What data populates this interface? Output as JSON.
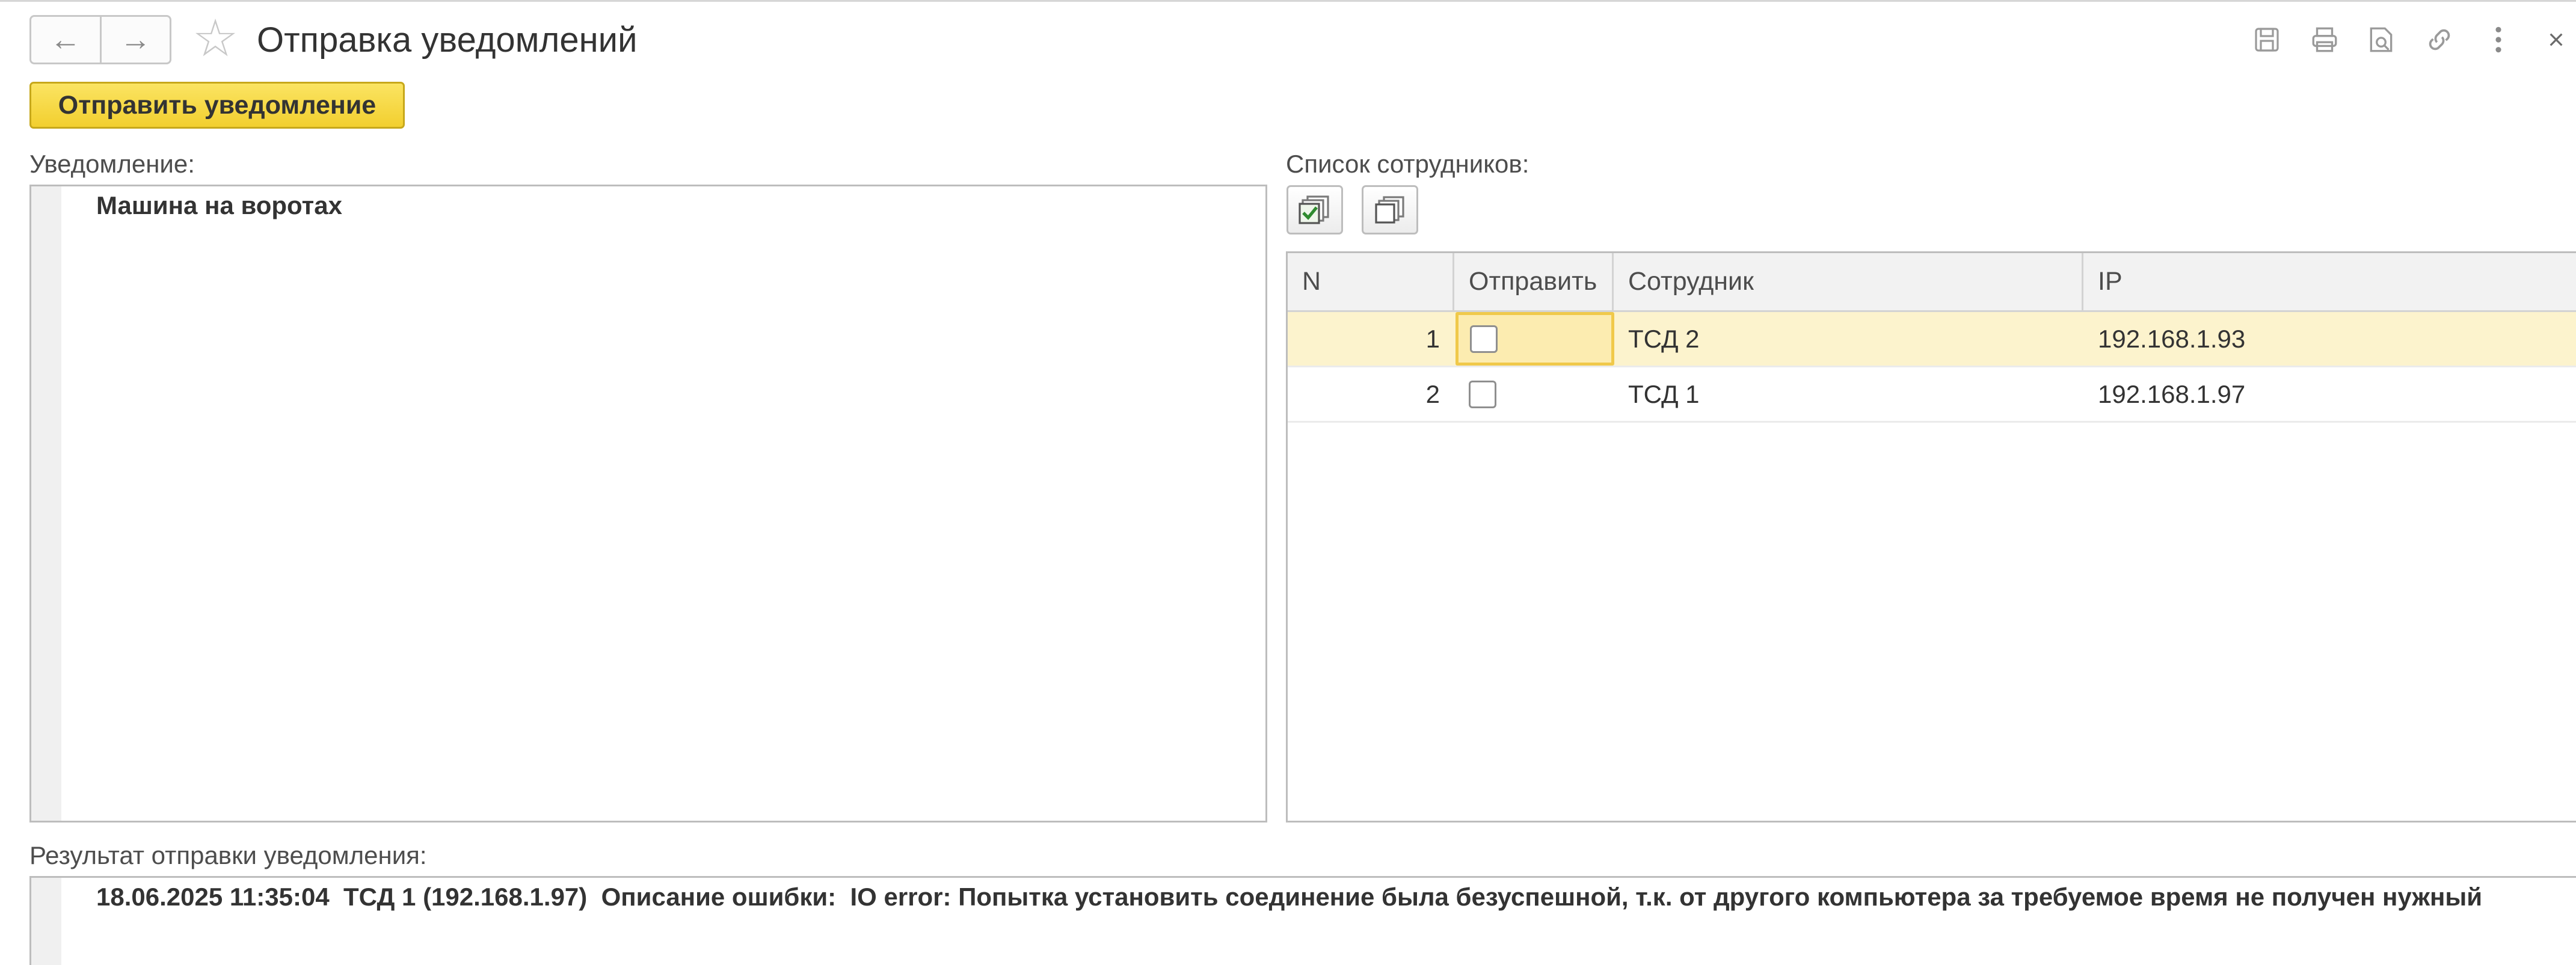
{
  "window": {
    "title": "Отправка уведомлений",
    "favorite_icon": "star-icon",
    "nav": {
      "back_icon": "arrow-left-icon",
      "forward_icon": "arrow-right-icon"
    },
    "toolbar_icons": [
      "save-icon",
      "print-icon",
      "preview-icon",
      "link-icon",
      "more-icon",
      "close-icon"
    ]
  },
  "actions": {
    "send_label": "Отправить уведомление"
  },
  "notification": {
    "label": "Уведомление:",
    "text": "Машина на воротах"
  },
  "employees": {
    "label": "Список сотрудников:",
    "columns": {
      "n": "N",
      "send": "Отправить",
      "employee": "Сотрудник",
      "ip": "IP"
    },
    "rows": [
      {
        "n": "1",
        "send": false,
        "employee": "ТСД 2",
        "ip": "192.168.1.93"
      },
      {
        "n": "2",
        "send": false,
        "employee": "ТСД 1",
        "ip": "192.168.1.97"
      }
    ]
  },
  "result": {
    "label": "Результат отправки уведомления:",
    "text": "18.06.2025 11:35:04  ТСД 1 (192.168.1.97)  Описание ошибки:  IO error: Попытка установить соединение была безуспешной, т.к. от другого компьютера за требуемое время не получен нужный"
  },
  "colors": {
    "accent_button": "#f5d43c",
    "selected_row": "#fcf3cd",
    "focus_border": "#f0c94a"
  }
}
